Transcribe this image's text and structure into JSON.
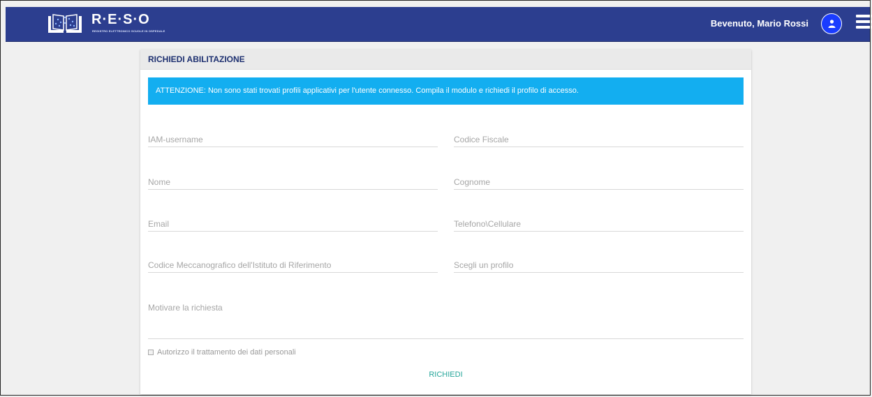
{
  "header": {
    "logo_text": "R·E·S·O",
    "logo_subtitle": "REGISTRO ELETTRONICO SCUOLE IN OSPEDALE",
    "welcome": "Bevenuto, Mario Rossi",
    "user_icon": "user-icon",
    "menu_icon": "hamburger-menu-icon",
    "bar_color": "#2c3e8f"
  },
  "card": {
    "title": "RICHIEDI ABILITAZIONE",
    "alert": "ATTENZIONE: Non sono stati trovati profili applicativi per l'utente connesso. Compila il modulo e richiedi il profilo di accesso.",
    "alert_color": "#13aef0"
  },
  "form": {
    "iam_username_placeholder": "IAM-username",
    "codice_fiscale_placeholder": "Codice Fiscale",
    "nome_placeholder": "Nome",
    "cognome_placeholder": "Cognome",
    "email_placeholder": "Email",
    "telefono_placeholder": "Telefono\\Cellulare",
    "codice_meccanografico_placeholder": "Codice Meccanografico dell'Istituto di Riferimento",
    "profilo_placeholder": "Scegli un profilo",
    "motivazione_placeholder": "Motivare la richiesta",
    "privacy_label": "Autorizzo il trattamento dei dati personali",
    "submit_label": "RICHIEDI"
  }
}
